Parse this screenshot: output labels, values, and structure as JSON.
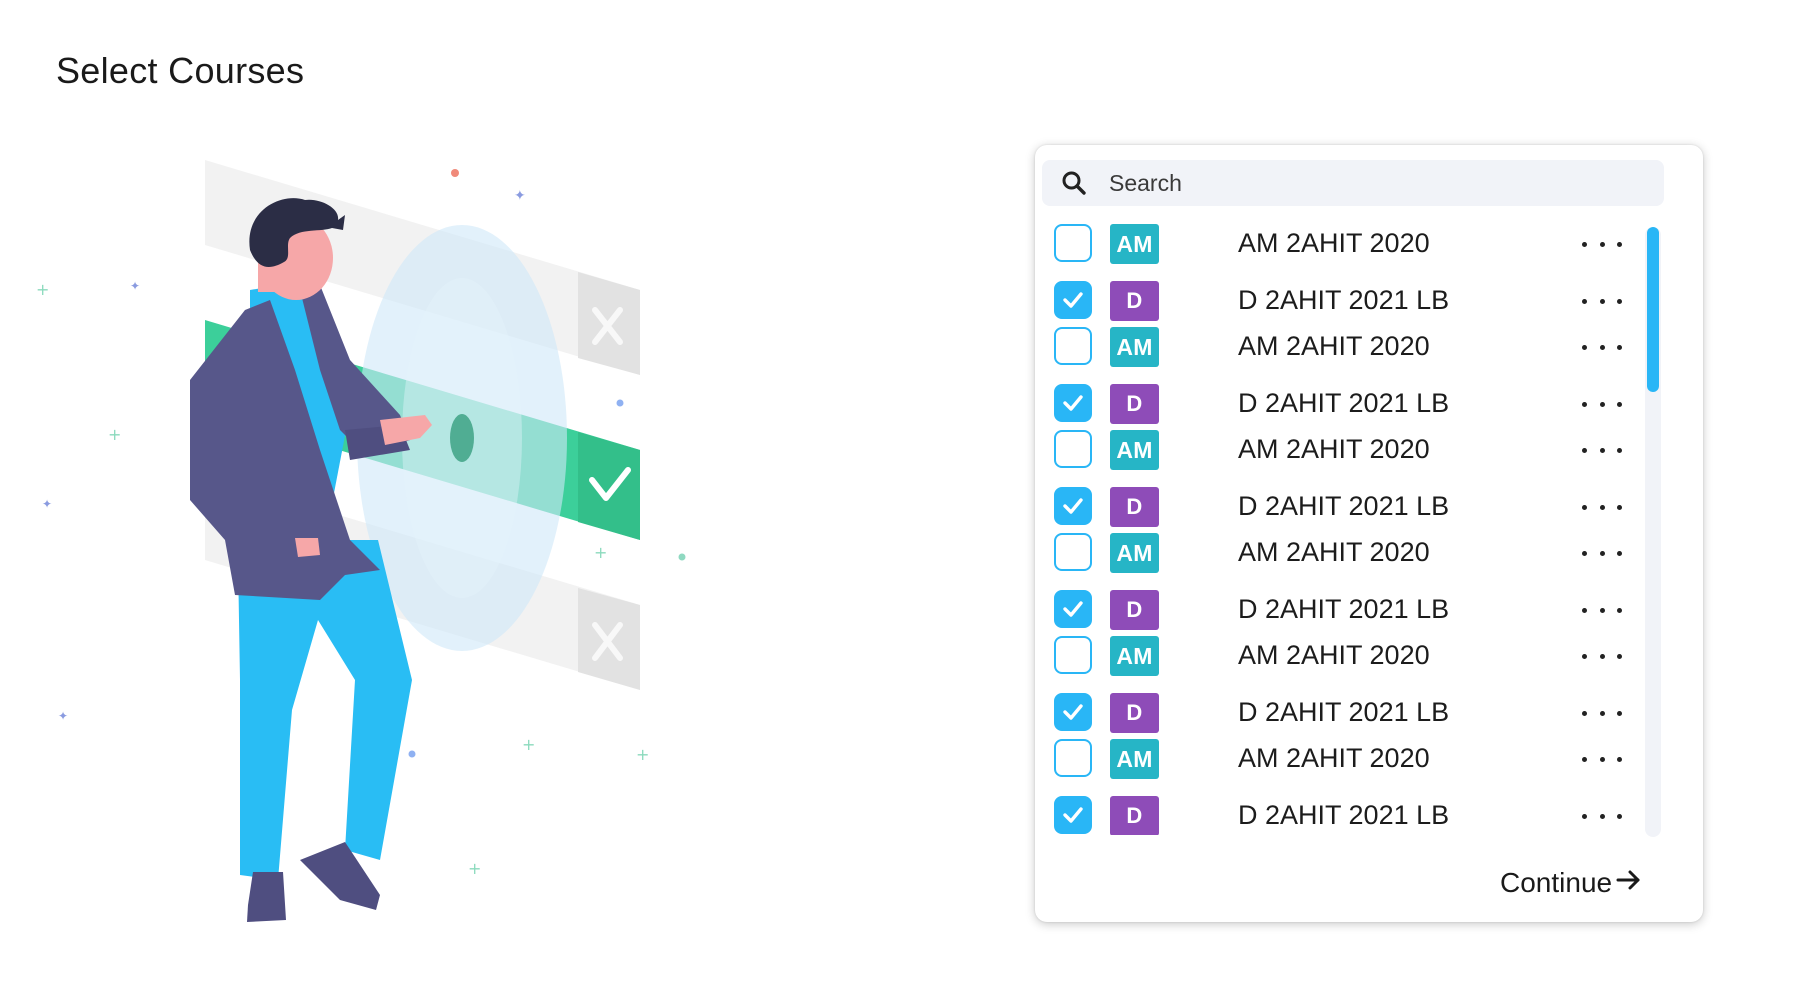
{
  "page": {
    "title": "Select Courses"
  },
  "illustration": {
    "icon": "person-selecting-checklist-illustration"
  },
  "search": {
    "placeholder": "Search",
    "value": "",
    "icon": "search-icon"
  },
  "courses": [
    {
      "badge": "AM",
      "name": "AM 2AHIT 2020",
      "checked": false
    },
    {
      "badge": "D",
      "name": "D 2AHIT 2021 LB",
      "checked": true
    },
    {
      "badge": "AM",
      "name": "AM 2AHIT 2020",
      "checked": false
    },
    {
      "badge": "D",
      "name": "D 2AHIT 2021 LB",
      "checked": true
    },
    {
      "badge": "AM",
      "name": "AM 2AHIT 2020",
      "checked": false
    },
    {
      "badge": "D",
      "name": "D 2AHIT 2021 LB",
      "checked": true
    },
    {
      "badge": "AM",
      "name": "AM 2AHIT 2020",
      "checked": false
    },
    {
      "badge": "D",
      "name": "D 2AHIT 2021 LB",
      "checked": true
    },
    {
      "badge": "AM",
      "name": "AM 2AHIT 2020",
      "checked": false
    },
    {
      "badge": "D",
      "name": "D 2AHIT 2021 LB",
      "checked": true
    },
    {
      "badge": "AM",
      "name": "AM 2AHIT 2020",
      "checked": false
    },
    {
      "badge": "D",
      "name": "D 2AHIT 2021 LB",
      "checked": true
    }
  ],
  "colors": {
    "accent": "#29b6f6",
    "badge_am": "#26b5c6",
    "badge_d": "#8e4cb8"
  },
  "footer": {
    "continue_label": "Continue",
    "continue_icon": "arrow-right-icon"
  }
}
